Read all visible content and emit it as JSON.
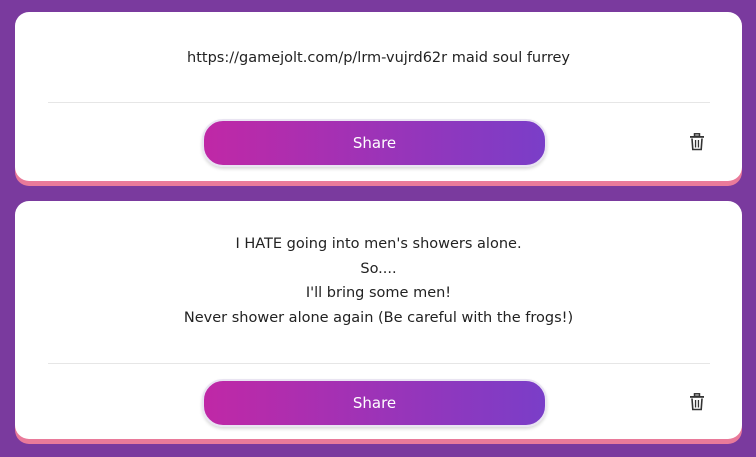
{
  "posts": [
    {
      "text": "https://gamejolt.com/p/lrm-vujrd62r maid soul furrey",
      "share_label": "Share",
      "delete_icon": "trash-icon"
    },
    {
      "text": "I HATE going into men's showers alone.\nSo....\nI'll bring some men!\nNever shower alone again (Be careful with the frogs!)",
      "share_label": "Share",
      "delete_icon": "trash-icon"
    }
  ],
  "colors": {
    "background": "#7a3a9e",
    "card": "#ffffff",
    "card_shadow": "#e97a9a",
    "button_gradient_start": "#c028a6",
    "button_gradient_end": "#7a3ec8"
  }
}
